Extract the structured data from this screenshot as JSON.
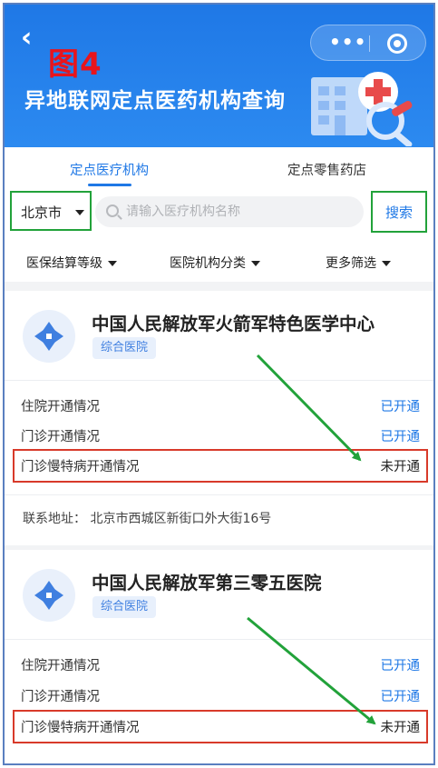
{
  "header": {
    "badge": "图4",
    "title": "异地联网定点医药机构查询",
    "color_primary": "#1f78e6"
  },
  "icons": {
    "back": "chevron-left-icon",
    "more": "more-dots-icon",
    "close": "target-circle-icon",
    "search": "search-icon",
    "logo": "hospital-logo-icon"
  },
  "tabs": [
    {
      "label": "定点医疗机构",
      "active": true
    },
    {
      "label": "定点零售药店",
      "active": false
    }
  ],
  "search": {
    "city": "北京市",
    "placeholder": "请输入医疗机构名称",
    "button": "搜索"
  },
  "filters": [
    {
      "label": "医保结算等级"
    },
    {
      "label": "医院机构分类"
    },
    {
      "label": "更多筛选"
    }
  ],
  "cards": [
    {
      "name": "中国人民解放军火箭军特色医学中心",
      "type": "综合医院",
      "rows": [
        {
          "label": "住院开通情况",
          "value": "已开通"
        },
        {
          "label": "门诊开通情况",
          "value": "已开通"
        },
        {
          "label": "门诊慢特病开通情况",
          "value": "未开通"
        }
      ],
      "address_label": "联系地址：",
      "address": "北京市西城区新街口外大街16号"
    },
    {
      "name": "中国人民解放军第三零五医院",
      "type": "综合医院",
      "rows": [
        {
          "label": "住院开通情况",
          "value": "已开通"
        },
        {
          "label": "门诊开通情况",
          "value": "已开通"
        },
        {
          "label": "门诊慢特病开通情况",
          "value": "未开通"
        }
      ]
    }
  ],
  "annotation_colors": {
    "box": "#d83a2a",
    "arrow": "#22a23a"
  }
}
